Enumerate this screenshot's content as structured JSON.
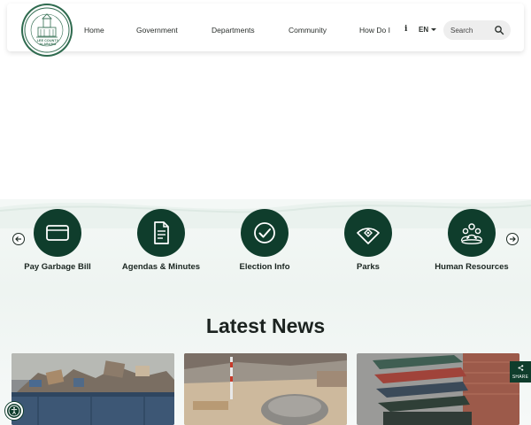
{
  "nav": {
    "items": [
      "Home",
      "Government",
      "Departments",
      "Community",
      "How Do I"
    ],
    "info_icon": "info-icon",
    "language": "EN",
    "search_placeholder": "Search"
  },
  "seal": {
    "text": "LEE COUNTY ALABAMA"
  },
  "quick_links": [
    {
      "label": "Pay Garbage Bill",
      "icon": "credit-card-icon"
    },
    {
      "label": "Agendas & Minutes",
      "icon": "document-icon"
    },
    {
      "label": "Election Info",
      "icon": "checkmark-icon"
    },
    {
      "label": "Parks",
      "icon": "baseball-field-icon"
    },
    {
      "label": "Human Resources",
      "icon": "people-group-icon"
    }
  ],
  "news": {
    "title": "Latest News",
    "cards": [
      {
        "image": "dumpster-debris-photo"
      },
      {
        "image": "construction-site-photo"
      },
      {
        "image": "garbage-bins-photo"
      }
    ]
  },
  "share": {
    "label": "SHARE"
  },
  "colors": {
    "brand_green": "#0f3d2c",
    "seal_green": "#2f6b4f",
    "hero_bg": "#f1f6f3"
  }
}
